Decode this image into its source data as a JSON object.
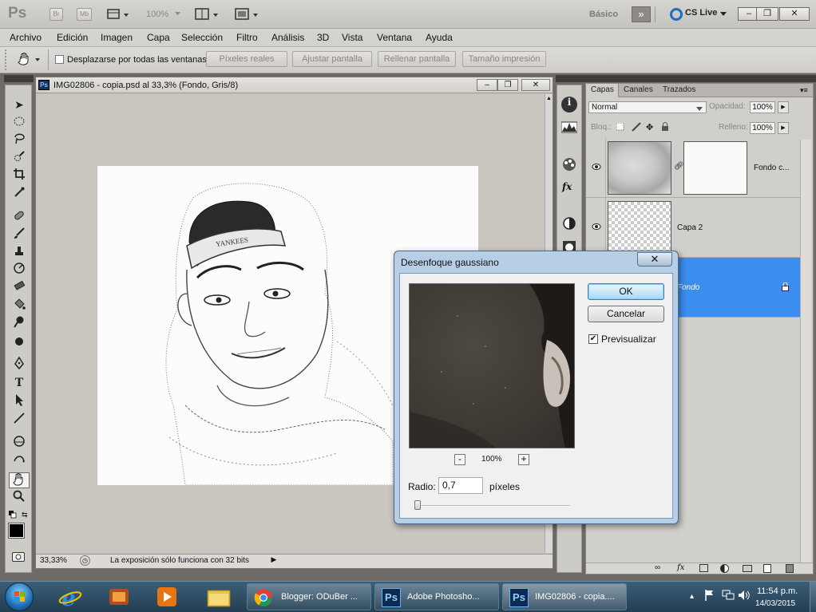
{
  "app": {
    "logo": "Ps",
    "bridge_label": "Br",
    "minibridge_label": "Mb",
    "zoom": "100%",
    "workspace": "Básico",
    "workspace_more": "»",
    "cs_live": "CS Live",
    "win_min": "–",
    "win_max": "❐",
    "win_close": "✕"
  },
  "menu": [
    "Archivo",
    "Edición",
    "Imagen",
    "Capa",
    "Selección",
    "Filtro",
    "Análisis",
    "3D",
    "Vista",
    "Ventana",
    "Ayuda"
  ],
  "options": {
    "scroll_all_label": "Desplazarse por todas las ventanas",
    "buttons": [
      "Píxeles reales",
      "Ajustar pantalla",
      "Rellenar pantalla",
      "Tamaño impresión"
    ]
  },
  "document": {
    "title": "IMG02806 - copia.psd al 33,3% (Fondo, Gris/8)",
    "zoom": "33,33%",
    "status": "La exposición sólo funciona con 32 bits",
    "cap_text": "YANKEES"
  },
  "layers_panel": {
    "tabs": [
      "Capas",
      "Canales",
      "Trazados"
    ],
    "blend_mode": "Normal",
    "opacity_label": "Opacidad:",
    "opacity_value": "100%",
    "lock_label": "Bloq.:",
    "fill_label": "Relleno:",
    "fill_value": "100%",
    "layers": [
      {
        "name": "Fondo c...",
        "visible": true
      },
      {
        "name": "Capa 2",
        "visible": true
      },
      {
        "name": "Fondo",
        "visible": true,
        "selected": true
      }
    ]
  },
  "dialog": {
    "title": "Desenfoque gaussiano",
    "close": "✕",
    "ok": "OK",
    "cancel": "Cancelar",
    "preview_label": "Previsualizar",
    "preview_checked": true,
    "zoom": "100%",
    "zoom_minus": "-",
    "zoom_plus": "+",
    "radius_label": "Radio:",
    "radius_value": "0,7",
    "radius_unit": "píxeles"
  },
  "taskbar": {
    "tasks": [
      {
        "label": "Blogger: ODuBer ..."
      },
      {
        "label": "Adobe Photosho..."
      },
      {
        "label": "IMG02806 - copia...."
      }
    ],
    "time": "11:54 p.m.",
    "date": "14/03/2015"
  },
  "colors": {
    "accent": "#3399ff",
    "selected_layer": "#3b8ef0",
    "taskbar": "#2c4a62"
  }
}
